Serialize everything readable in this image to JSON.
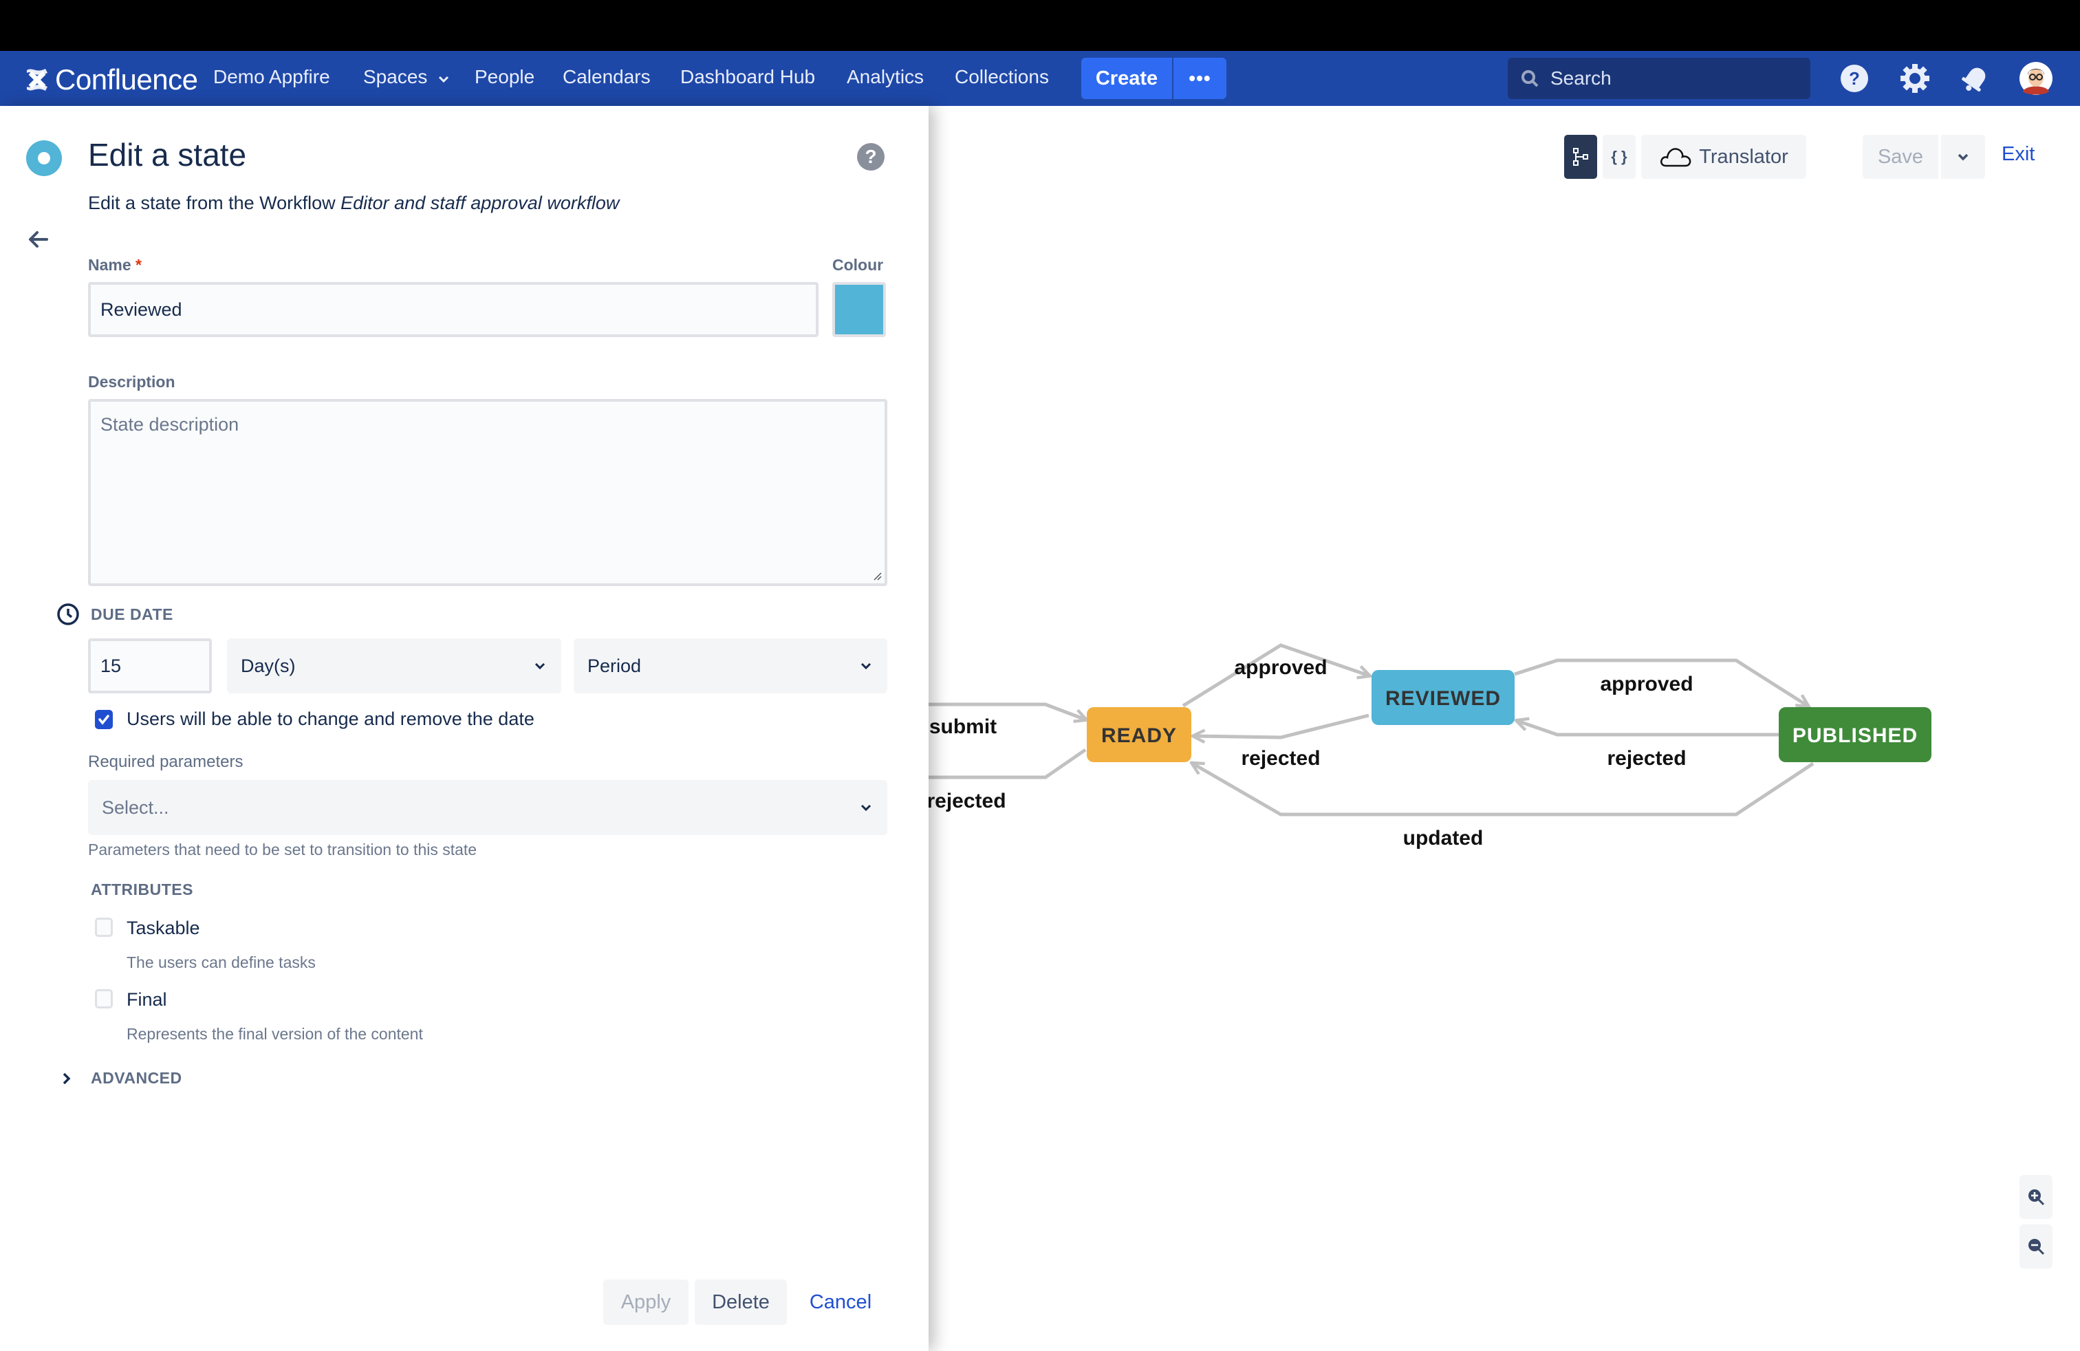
{
  "nav": {
    "product": "Confluence",
    "site": "Demo Appfire",
    "items": [
      {
        "label": "Spaces",
        "has_dropdown": true
      },
      {
        "label": "People"
      },
      {
        "label": "Calendars"
      },
      {
        "label": "Dashboard Hub"
      },
      {
        "label": "Analytics"
      },
      {
        "label": "Collections"
      }
    ],
    "create_label": "Create",
    "more_label": "•••",
    "search_placeholder": "Search",
    "icons": [
      "help-icon",
      "settings-icon",
      "notifications-icon",
      "avatar"
    ]
  },
  "panel": {
    "title": "Edit a state",
    "subtitle_prefix": "Edit a state from the Workflow ",
    "subtitle_workflow": "Editor and staff approval workflow",
    "name_label": "Name",
    "name_required_mark": "*",
    "name_value": "Reviewed",
    "colour_label": "Colour",
    "colour_value": "#52b4d6",
    "description_label": "Description",
    "description_placeholder": "State description",
    "description_value": "",
    "due_date": {
      "heading": "DUE DATE",
      "amount": "15",
      "unit": "Day(s)",
      "period": "Period",
      "user_change_label": "Users will be able to change and remove the date",
      "user_change_checked": true
    },
    "required_parameters": {
      "label": "Required parameters",
      "placeholder": "Select...",
      "help": "Parameters that need to be set to transition to this state"
    },
    "attributes": {
      "heading": "ATTRIBUTES",
      "items": [
        {
          "label": "Taskable",
          "help": "The users can define tasks",
          "checked": false
        },
        {
          "label": "Final",
          "help": "Represents the final version of the content",
          "checked": false
        }
      ]
    },
    "advanced_label": "ADVANCED",
    "buttons": {
      "apply": "Apply",
      "delete": "Delete",
      "cancel": "Cancel"
    }
  },
  "toolbar": {
    "code_label": "{ }",
    "translator_label": "Translator",
    "save_label": "Save",
    "exit_label": "Exit"
  },
  "workflow": {
    "states": [
      {
        "id": "ready",
        "label": "READY",
        "color": "#f2af3e",
        "text_color": "#333333"
      },
      {
        "id": "reviewed",
        "label": "REVIEWED",
        "color": "#52b4d6",
        "text_color": "#333333"
      },
      {
        "id": "published",
        "label": "PUBLISHED",
        "color": "#3f8b3a",
        "text_color": "#ffffff"
      }
    ],
    "transitions": [
      {
        "label": "submit",
        "from": "(off-screen)",
        "to": "ready"
      },
      {
        "label": "rejected",
        "from": "ready",
        "to": "(off-screen)"
      },
      {
        "label": "approved",
        "from": "ready",
        "to": "reviewed"
      },
      {
        "label": "rejected",
        "from": "reviewed",
        "to": "ready"
      },
      {
        "label": "approved",
        "from": "reviewed",
        "to": "published"
      },
      {
        "label": "rejected",
        "from": "published",
        "to": "reviewed"
      },
      {
        "label": "updated",
        "from": "published",
        "to": "ready"
      }
    ],
    "edge_color": "#c1c1c1"
  }
}
